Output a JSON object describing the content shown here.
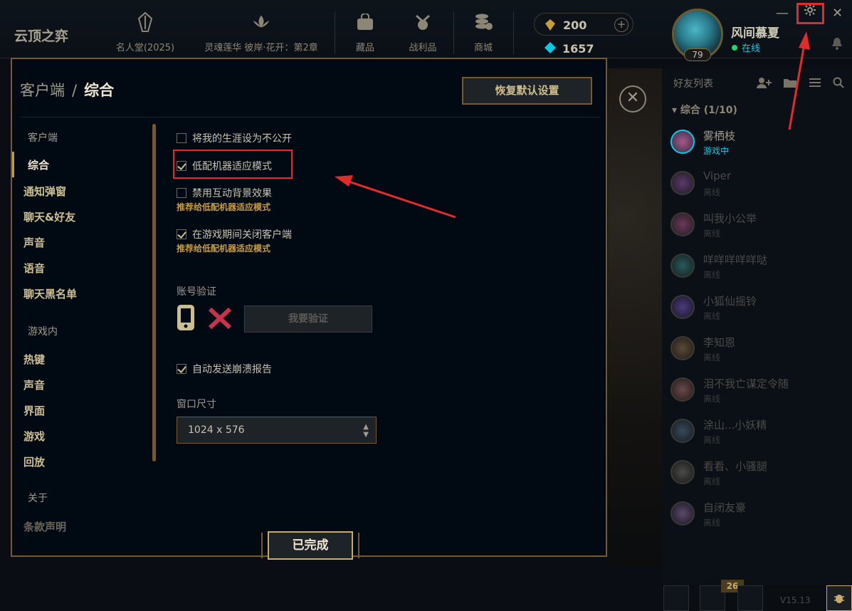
{
  "app": {
    "title": "云顶之弈"
  },
  "nav": [
    {
      "label": "名人堂(2025)",
      "icon": "crystal-icon"
    },
    {
      "label": "灵魂莲华 彼岸·花开：第2章",
      "icon": "lotus-icon"
    },
    {
      "label": "藏品",
      "icon": "bag-icon"
    },
    {
      "label": "战利品",
      "icon": "loot-icon"
    },
    {
      "label": "商城",
      "icon": "coins-icon"
    }
  ],
  "currency": {
    "rp": "200",
    "be": "1657"
  },
  "profile": {
    "name": "风间慕夏",
    "status": "在线",
    "level": "79"
  },
  "friends": {
    "header": "好友列表",
    "group": "综合 (1/10)",
    "list": [
      {
        "name": "雾栖枝",
        "status": "游戏中"
      },
      {
        "name": "Viper",
        "status": "离线"
      },
      {
        "name": "叫我小公举",
        "status": "离线"
      },
      {
        "name": "咩咩咩咩咩哒",
        "status": "离线"
      },
      {
        "name": "小狐仙摇铃",
        "status": "离线"
      },
      {
        "name": "李知恩",
        "status": "离线"
      },
      {
        "name": "泪不我亡谋定令随",
        "status": "离线"
      },
      {
        "name": "涂山...小妖精",
        "status": "离线"
      },
      {
        "name": "看看、小骚腿",
        "status": "离线"
      },
      {
        "name": "自闭友豪",
        "status": "离线"
      }
    ]
  },
  "bottom": {
    "badge": "26",
    "version": "V15.13"
  },
  "settings": {
    "breadcrumb_parent": "客户端",
    "breadcrumb_sep": "/",
    "breadcrumb_current": "综合",
    "reset_label": "恢复默认设置",
    "side": {
      "client_section": "客户端",
      "client_items": [
        "综合",
        "通知弹窗",
        "聊天&好友",
        "声音",
        "语音",
        "聊天黑名单"
      ],
      "ingame_section": "游戏内",
      "ingame_items": [
        "热键",
        "声音",
        "界面",
        "游戏",
        "回放"
      ],
      "about_section": "关于",
      "about_items": [
        "条款声明"
      ]
    },
    "options": {
      "private_career": "将我的生涯设为不公开",
      "low_spec": "低配机器适应模式",
      "disable_bg": "禁用互动背景效果",
      "disable_bg_hint": "推荐给低配机器适应模式",
      "close_client": "在游戏期间关闭客户端",
      "close_client_hint": "推荐给低配机器适应模式",
      "crash_report": "自动发送崩溃报告"
    },
    "account_verify_label": "账号验证",
    "verify_button": "我要验证",
    "window_size_label": "窗口尺寸",
    "window_size_value": "1024 x 576",
    "done_label": "已完成"
  },
  "colors": {
    "gold": "#c89b3c",
    "annotation_red": "#e32b2b",
    "online_blue": "#0acbe6"
  }
}
